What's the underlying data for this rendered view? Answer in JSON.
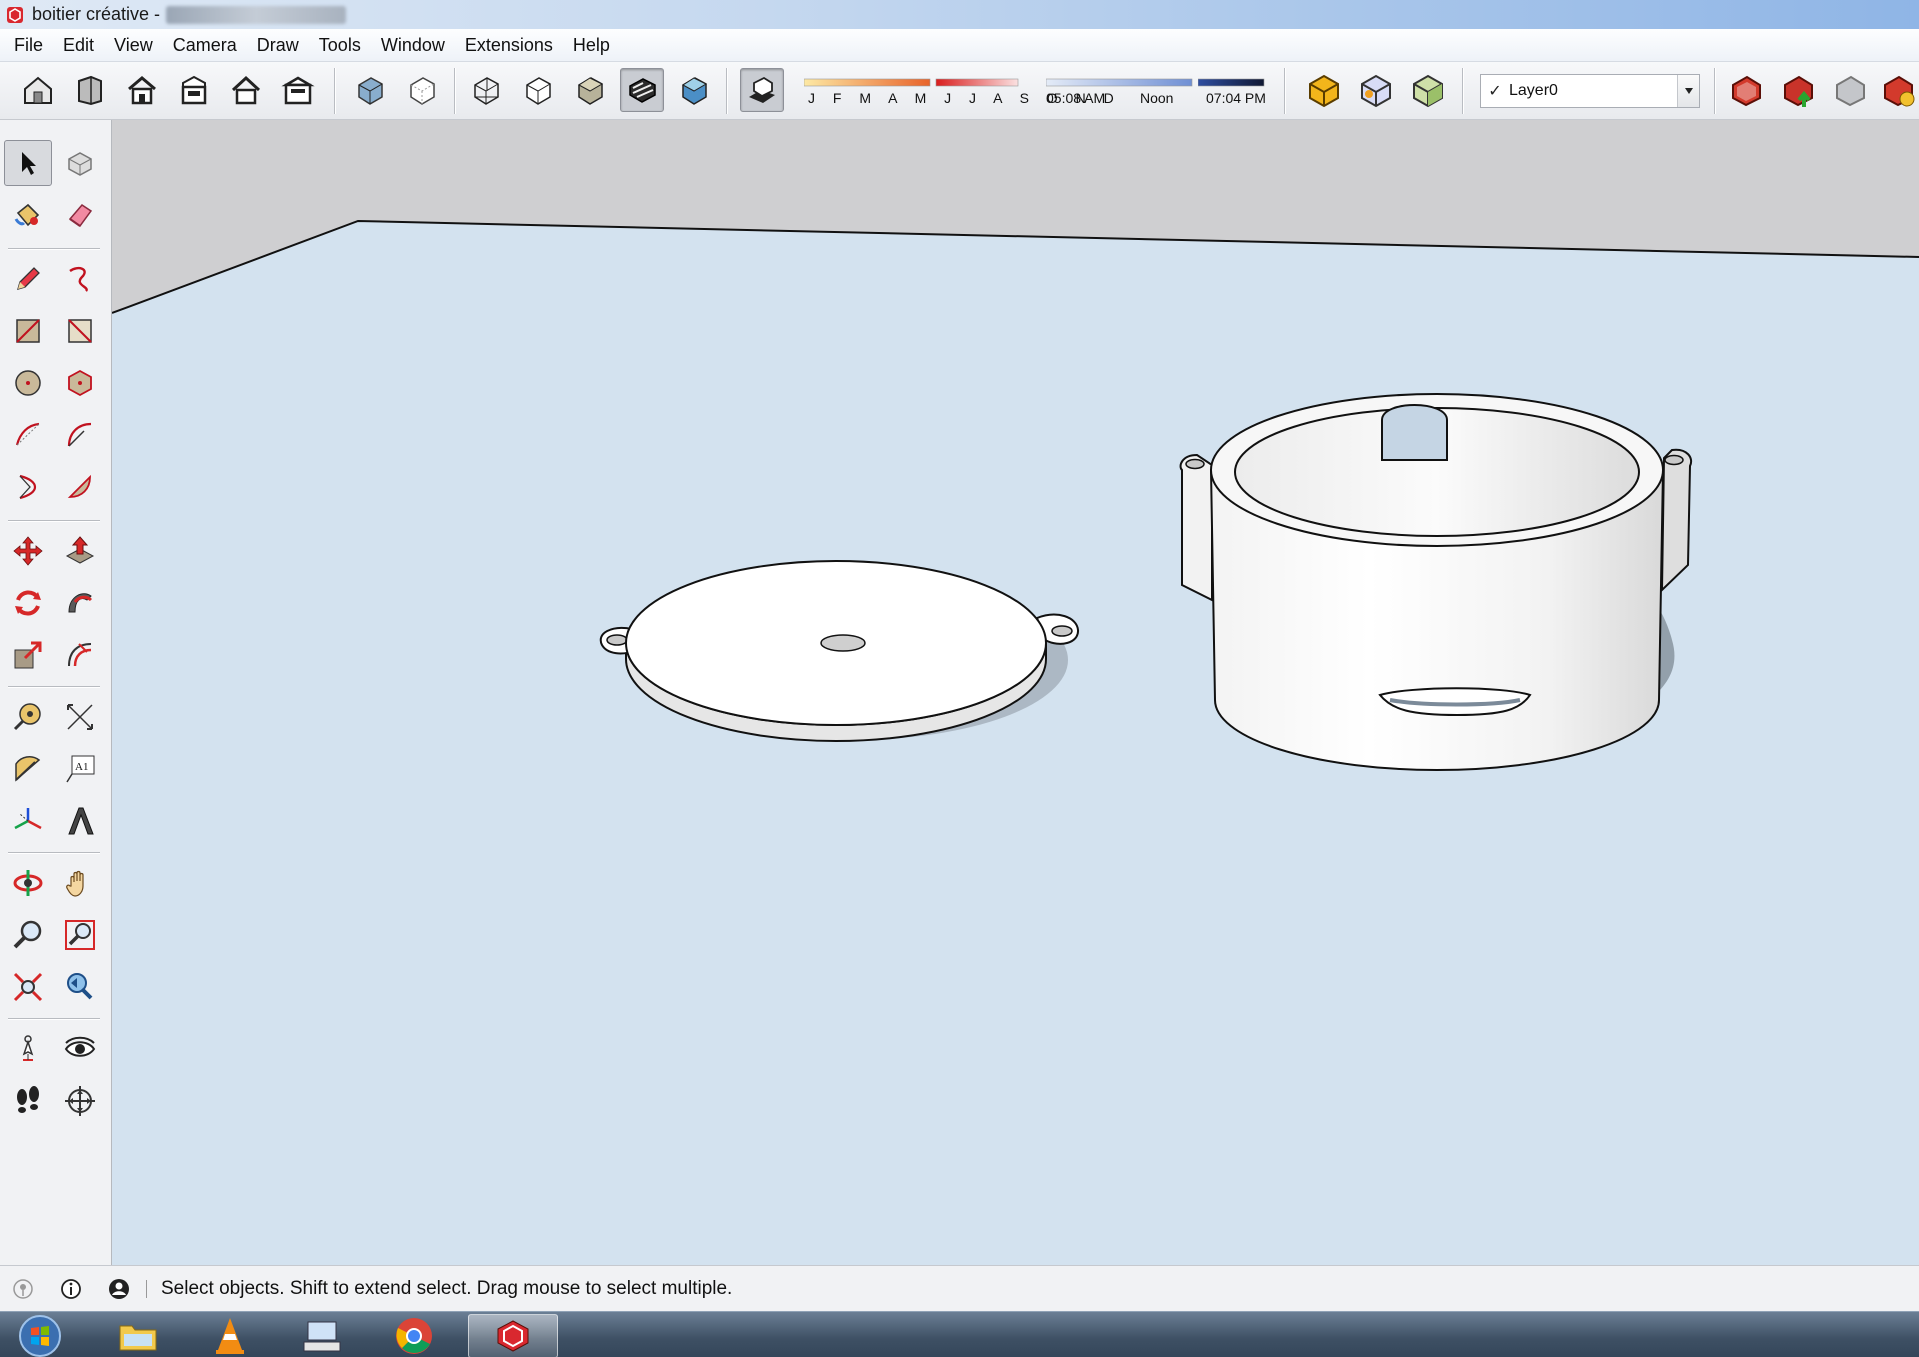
{
  "window": {
    "title": "boitier créative -"
  },
  "menu": [
    "File",
    "Edit",
    "View",
    "Camera",
    "Draw",
    "Tools",
    "Window",
    "Extensions",
    "Help"
  ],
  "toolbar": {
    "months": "J F M A M J J A S O N D",
    "time_start": "05:08 AM",
    "time_mid": "Noon",
    "time_end": "07:04 PM",
    "layer_name": "Layer0",
    "layer_check": "✓"
  },
  "status": {
    "text": "Select objects. Shift to extend select. Drag mouse to select multiple."
  },
  "colors": {
    "viewport_bg": "#d3e2ef",
    "sky": "#cfcfd1",
    "model_face": "#ffffff",
    "edge": "#111111"
  },
  "icons": {
    "palette": [
      "select-icon",
      "make-component-icon",
      "paint-bucket-icon",
      "eraser-icon",
      "pencil-icon",
      "freehand-icon",
      "rectangle-icon",
      "rotated-rectangle-icon",
      "circle-icon",
      "polygon-icon",
      "arc-icon",
      "two-point-arc-icon",
      "three-point-arc-icon",
      "pie-icon",
      "move-icon",
      "push-pull-icon",
      "rotate-icon",
      "follow-me-icon",
      "scale-icon",
      "offset-icon",
      "tape-measure-icon",
      "dimension-icon",
      "protractor-icon",
      "text-icon",
      "axes-icon",
      "3d-text-icon",
      "orbit-icon",
      "pan-icon",
      "zoom-icon",
      "zoom-window-icon",
      "zoom-extents-icon",
      "previous-view-icon",
      "position-camera-icon",
      "look-around-icon",
      "walk-icon",
      "section-plane-icon"
    ]
  }
}
